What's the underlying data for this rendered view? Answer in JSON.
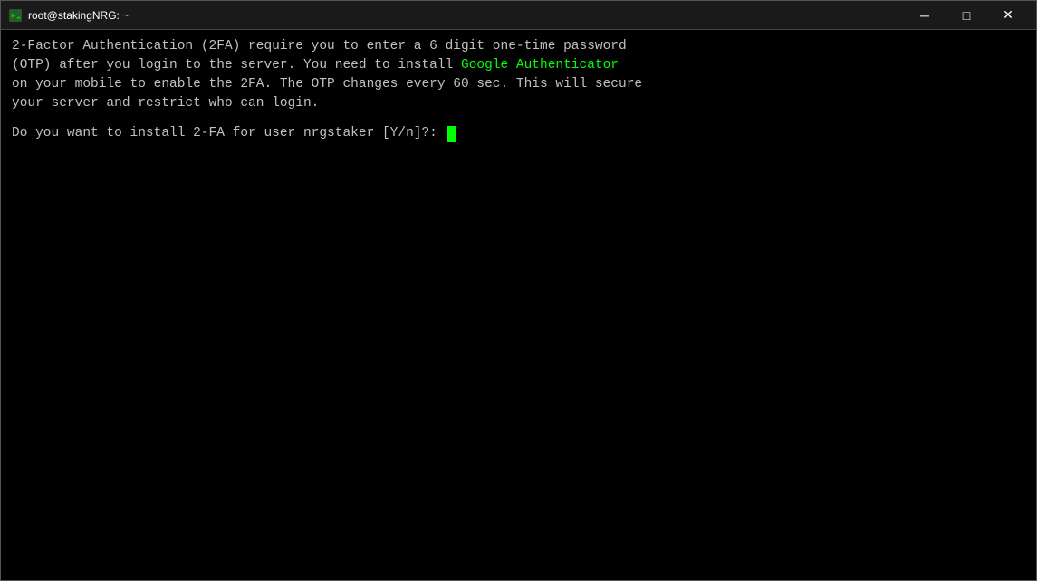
{
  "window": {
    "title": "root@stakingNRG: ~",
    "icon": "terminal-icon"
  },
  "titlebar": {
    "minimize_label": "─",
    "maximize_label": "□",
    "close_label": "✕"
  },
  "terminal": {
    "line1": "2-Factor Authentication (2FA) require you to enter a 6 digit one-time password",
    "line2": "(OTP) after you login to the server. You need to install ",
    "google_authenticator": "Google Authenticator",
    "line3": "on your mobile to enable the 2FA. The OTP changes every 60 sec. This will secure",
    "line4": "your server and restrict who can login.",
    "prompt": "Do you want to install 2-FA for user nrgstaker [Y/n]?: "
  }
}
